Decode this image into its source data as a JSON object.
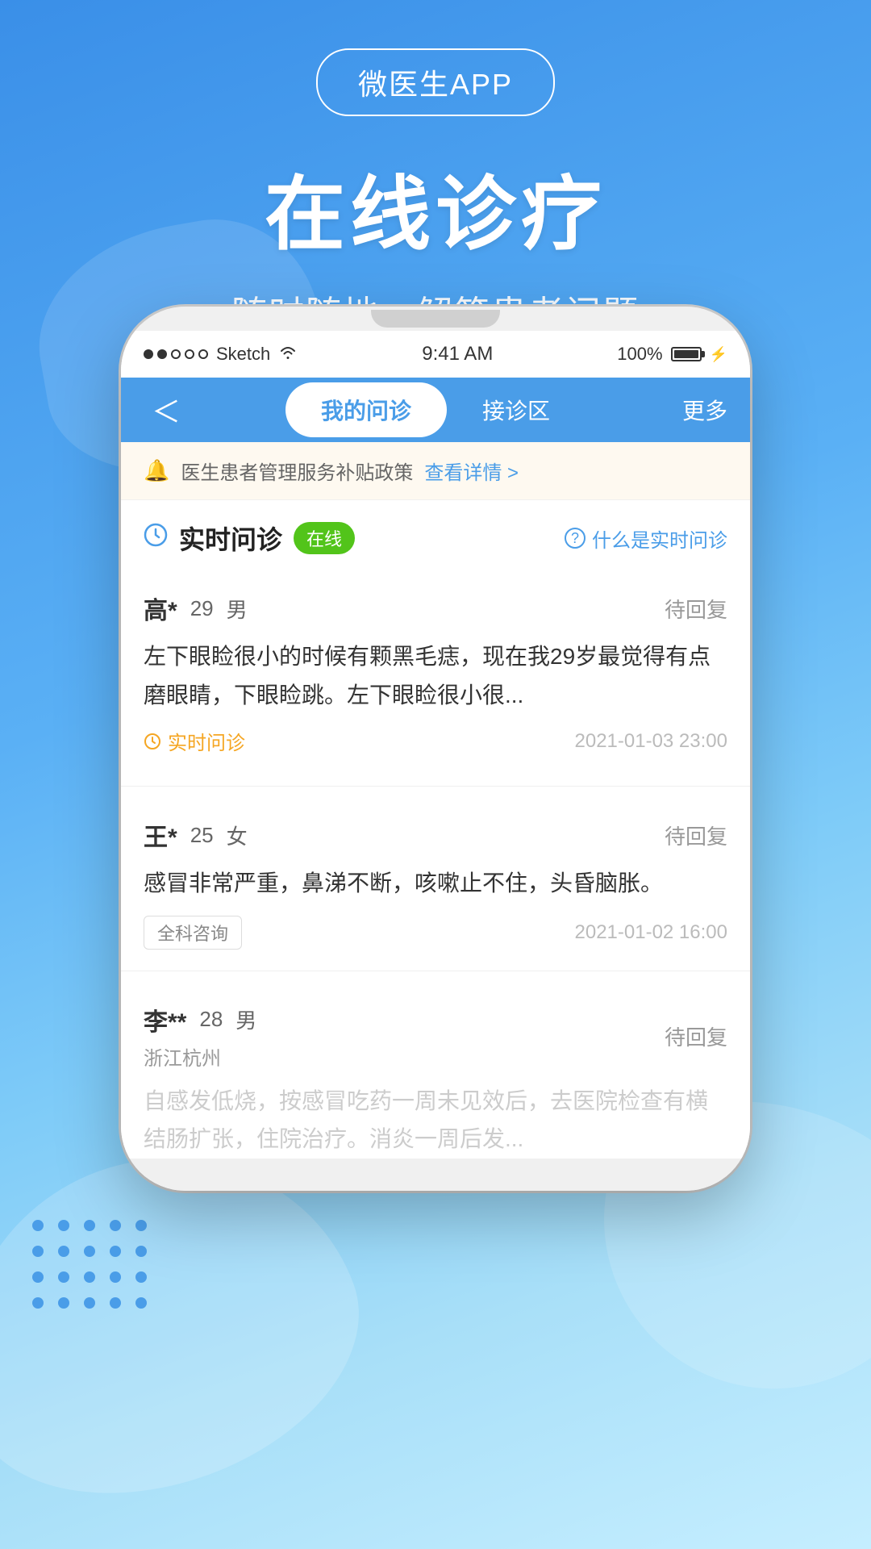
{
  "app": {
    "badge": "微医生APP",
    "main_title": "在线诊疗",
    "sub_title": "随时随地，解答患者问题"
  },
  "phone": {
    "status_bar": {
      "signal": "●●○○○",
      "carrier": "Sketch",
      "wifi": "WiFi",
      "time": "9:41 AM",
      "battery": "100%"
    },
    "nav": {
      "back": "＜",
      "tab1": "我的问诊",
      "tab2": "接诊区",
      "more": "更多"
    },
    "notice": {
      "icon": "🔔",
      "text": "医生患者管理服务补贴政策",
      "link": "查看详情 >"
    },
    "realtime": {
      "icon": "🕐",
      "label": "实时问诊",
      "badge": "在线",
      "help_icon": "?",
      "help_text": "什么是实时问诊"
    },
    "patients": [
      {
        "name": "高*",
        "age": "29",
        "gender": "男",
        "status": "待回复",
        "desc": "左下眼睑很小的时候有颗黑毛痣，现在我29岁最觉得有点磨眼睛，下眼睑跳。左下眼睑很小很...",
        "type": "实时问诊",
        "type_color": "orange",
        "time": "2021-01-03 23:00"
      },
      {
        "name": "王*",
        "age": "25",
        "gender": "女",
        "status": "待回复",
        "desc": "感冒非常严重，鼻涕不断，咳嗽止不住，头昏脑胀。",
        "type": "全科咨询",
        "type_color": "gray",
        "time": "2021-01-02 16:00"
      },
      {
        "name": "李**",
        "age": "28",
        "gender": "男",
        "location": "浙江杭州",
        "status": "待回复",
        "desc": "自感发低烧，按感冒吃药一周未见效后，去医院检查有横结肠扩张，住院治疗。消炎一周后发...",
        "type": "",
        "time": ""
      }
    ]
  }
}
